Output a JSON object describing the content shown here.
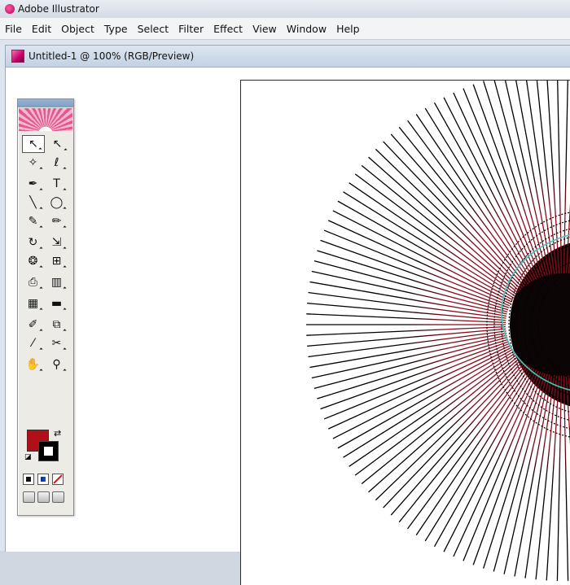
{
  "app": {
    "title": "Adobe Illustrator",
    "icon": "illustrator-flower-icon"
  },
  "menu": {
    "items": [
      "File",
      "Edit",
      "Object",
      "Type",
      "Select",
      "Filter",
      "Effect",
      "View",
      "Window",
      "Help"
    ]
  },
  "document": {
    "title": "Untitled-1 @ 100% (RGB/Preview)",
    "icon": "illustrator-document-icon"
  },
  "toolbox": {
    "tools": [
      [
        "selection-tool-icon",
        "direct-selection-tool-icon"
      ],
      [
        "magic-wand-tool-icon",
        "lasso-tool-icon"
      ],
      [
        "pen-tool-icon",
        "type-tool-icon"
      ],
      [
        "line-segment-tool-icon",
        "ellipse-tool-icon"
      ],
      [
        "paintbrush-tool-icon",
        "pencil-tool-icon"
      ],
      [
        "rotate-tool-icon",
        "scale-tool-icon"
      ],
      [
        "warp-tool-icon",
        "free-transform-tool-icon"
      ],
      [
        "symbol-sprayer-tool-icon",
        "column-graph-tool-icon"
      ],
      [
        "mesh-tool-icon",
        "gradient-tool-icon"
      ],
      [
        "eyedropper-tool-icon",
        "blend-tool-icon"
      ],
      [
        "slice-tool-icon",
        "scissors-tool-icon"
      ],
      [
        "hand-tool-icon",
        "zoom-tool-icon"
      ]
    ],
    "tool_glyphs": {
      "selection-tool-icon": "↖",
      "direct-selection-tool-icon": "↖",
      "magic-wand-tool-icon": "✧",
      "lasso-tool-icon": "ℓ",
      "pen-tool-icon": "✒",
      "type-tool-icon": "T",
      "line-segment-tool-icon": "╲",
      "ellipse-tool-icon": "◯",
      "paintbrush-tool-icon": "✎",
      "pencil-tool-icon": "✏",
      "rotate-tool-icon": "↻",
      "scale-tool-icon": "⇲",
      "warp-tool-icon": "❂",
      "free-transform-tool-icon": "⊞",
      "symbol-sprayer-tool-icon": "⎙",
      "column-graph-tool-icon": "▥",
      "mesh-tool-icon": "▦",
      "gradient-tool-icon": "▬",
      "eyedropper-tool-icon": "✐",
      "blend-tool-icon": "⧉",
      "slice-tool-icon": "⁄",
      "scissors-tool-icon": "✂",
      "hand-tool-icon": "✋",
      "zoom-tool-icon": "⚲"
    },
    "selected_tool": "selection-tool-icon",
    "fill_color": "#b01018",
    "stroke_color": "#000000"
  },
  "colors": {
    "ray_color": "#000000",
    "ray_center_color": "#8a0a1a",
    "ellipse_outline": "#3fc7b8"
  }
}
